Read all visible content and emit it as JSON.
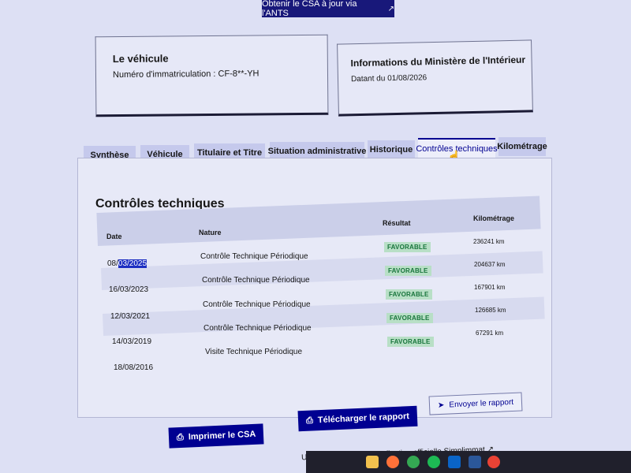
{
  "header": {
    "ants_button_label": "Obtenir le CSA à jour via l'ANTS",
    "external_icon": "↗"
  },
  "vehicle_card": {
    "title": "Le véhicule",
    "registration": "Numéro d'immatriculation : CF-8**-YH"
  },
  "ministry_card": {
    "title": "Informations du Ministère de l'Intérieur",
    "date_text": "Datant du 01/08/2026"
  },
  "tabs": [
    {
      "label": "Synthèse"
    },
    {
      "label": "Véhicule"
    },
    {
      "label": "Titulaire et Titre"
    },
    {
      "label": "Situation administrative"
    },
    {
      "label": "Historique"
    },
    {
      "label": "Contrôles techniques",
      "active": true
    },
    {
      "label": "Kilométrage"
    }
  ],
  "main": {
    "section_title": "Contrôles techniques",
    "columns": {
      "date": "Date",
      "nature": "Nature",
      "result": "Résultat",
      "mileage": "Kilométrage"
    },
    "rows": [
      {
        "date_prefix": "08/",
        "date_selected": "03/2025",
        "nature": "Contrôle Technique Périodique",
        "result": "FAVORABLE",
        "mileage": "236241 km"
      },
      {
        "date": "16/03/2023",
        "nature": "Contrôle Technique Périodique",
        "result": "FAVORABLE",
        "mileage": "204637 km"
      },
      {
        "date": "12/03/2021",
        "nature": "Contrôle Technique Périodique",
        "result": "FAVORABLE",
        "mileage": "167901 km"
      },
      {
        "date": "14/03/2019",
        "nature": "Contrôle Technique Périodique",
        "result": "FAVORABLE",
        "mileage": "126685 km"
      },
      {
        "date": "18/08/2016",
        "nature": "Visite Technique Périodique",
        "result": "FAVORABLE",
        "mileage": "67291 km"
      }
    ]
  },
  "actions": {
    "send_report": "Envoyer le rapport",
    "download_report": "Télécharger le rapport",
    "print_csa": "Imprimer le CSA"
  },
  "footer": {
    "prefix": "Utilisez maintenant l'application officielle ",
    "link": "Simplimmat"
  },
  "colors": {
    "primary": "#000091",
    "success_text": "#18753c",
    "success_bg": "#b8dfc6",
    "page_bg": "#dde0f4"
  }
}
